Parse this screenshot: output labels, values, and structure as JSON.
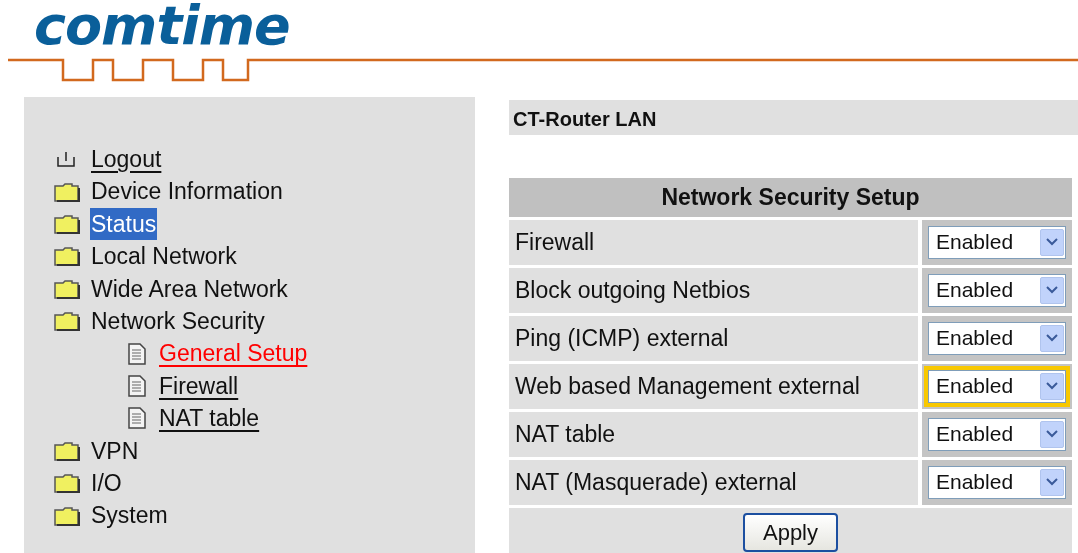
{
  "logo": {
    "text": "comtime"
  },
  "sidebar": {
    "items": [
      {
        "label": "Logout",
        "kind": "logout",
        "highlighted": false,
        "active": false
      },
      {
        "label": "Device Information",
        "kind": "folder",
        "highlighted": false,
        "active": false
      },
      {
        "label": "Status",
        "kind": "folder",
        "highlighted": true,
        "active": false
      },
      {
        "label": "Local Network",
        "kind": "folder",
        "highlighted": false,
        "active": false
      },
      {
        "label": "Wide Area Network",
        "kind": "folder",
        "highlighted": false,
        "active": false
      },
      {
        "label": "Network Security",
        "kind": "folder",
        "highlighted": false,
        "active": false,
        "children": [
          {
            "label": "General Setup",
            "kind": "page",
            "highlighted": false,
            "active": true
          },
          {
            "label": "Firewall",
            "kind": "page",
            "highlighted": false,
            "active": false
          },
          {
            "label": "NAT table",
            "kind": "page",
            "highlighted": false,
            "active": false
          }
        ]
      },
      {
        "label": "VPN",
        "kind": "folder",
        "highlighted": false,
        "active": false
      },
      {
        "label": "I/O",
        "kind": "folder",
        "highlighted": false,
        "active": false
      },
      {
        "label": "System",
        "kind": "folder",
        "highlighted": false,
        "active": false
      }
    ]
  },
  "page_title": "CT-Router LAN",
  "table": {
    "title": "Network Security Setup",
    "rows": [
      {
        "label": "Firewall",
        "value": "Enabled",
        "focused": false
      },
      {
        "label": "Block outgoing Netbios",
        "value": "Enabled",
        "focused": false
      },
      {
        "label": "Ping (ICMP) external",
        "value": "Enabled",
        "focused": false
      },
      {
        "label": "Web based Management external",
        "value": "Enabled",
        "focused": true
      },
      {
        "label": "NAT table",
        "value": "Enabled",
        "focused": false
      },
      {
        "label": "NAT (Masquerade) external",
        "value": "Enabled",
        "focused": false
      }
    ],
    "button": "Apply"
  }
}
